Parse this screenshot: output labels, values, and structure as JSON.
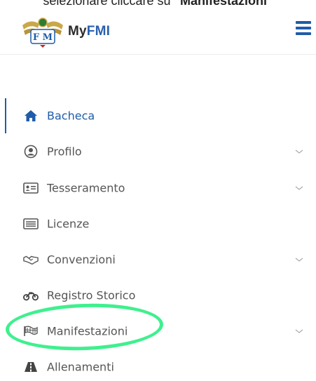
{
  "caption": {
    "prefix": "selezionare cliccare su ",
    "bold": "\"Manifestazioni\""
  },
  "header": {
    "brand_prefix": "My",
    "brand_accent": "FMI"
  },
  "colors": {
    "accent": "#1f5ca9",
    "highlight": "#3ff08e",
    "text": "#555555"
  },
  "menu": {
    "items": [
      {
        "label": "Bacheca",
        "icon": "home-icon",
        "active": true,
        "has_chevron": false
      },
      {
        "label": "Profilo",
        "icon": "user-circle-icon",
        "active": false,
        "has_chevron": true
      },
      {
        "label": "Tesseramento",
        "icon": "id-card-icon",
        "active": false,
        "has_chevron": true
      },
      {
        "label": "Licenze",
        "icon": "list-card-icon",
        "active": false,
        "has_chevron": false
      },
      {
        "label": "Convenzioni",
        "icon": "handshake-icon",
        "active": false,
        "has_chevron": true
      },
      {
        "label": "Registro Storico",
        "icon": "motorcycle-icon",
        "active": false,
        "has_chevron": false
      },
      {
        "label": "Manifestazioni",
        "icon": "checkered-flag-icon",
        "active": false,
        "has_chevron": true
      },
      {
        "label": "Allenamenti",
        "icon": "road-icon",
        "active": false,
        "has_chevron": false
      }
    ]
  }
}
